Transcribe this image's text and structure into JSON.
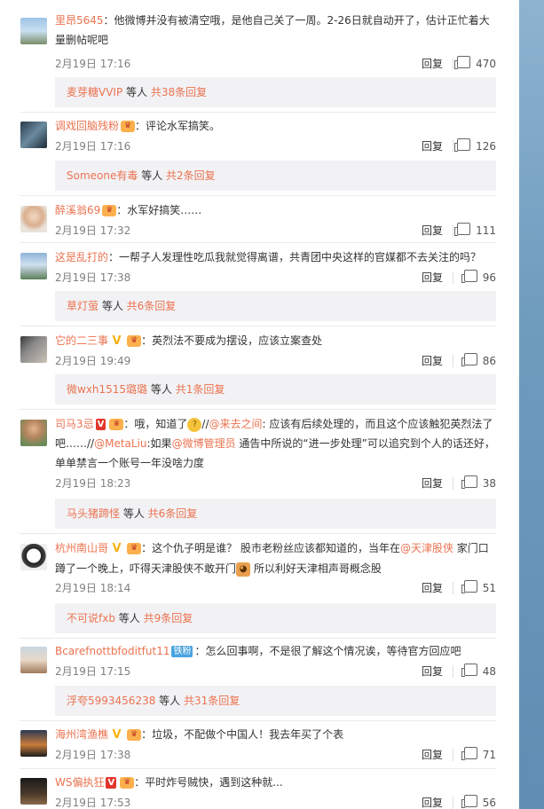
{
  "comments": [
    {
      "user": "里昂5645",
      "text": "：他微博并没有被清空哦，是他自己关了一周。2-26日就自动开了，估计正忙着大量删帖呢吧",
      "date": "2月19日 17:16",
      "reply": "回复",
      "likes": "470",
      "sub": {
        "user": "麦芽糖VVIP",
        "mid": " 等人 ",
        "count": "共38条回复"
      }
    },
    {
      "user": "调戏回脑残粉",
      "text": "：评论水军搞笑。",
      "date": "2月19日 17:16",
      "reply": "回复",
      "likes": "126",
      "sub": {
        "user": "Someone有毒",
        "mid": " 等人 ",
        "count": "共2条回复"
      }
    },
    {
      "user": "醉溪翁69",
      "text": "：水军好搞笑……",
      "date": "2月19日 17:32",
      "reply": "回复",
      "likes": "111"
    },
    {
      "user": "这是乱打的",
      "text": "：一帮子人发理性吃瓜我就觉得离谱，共青团中央这样的官媒都不去关注的吗？",
      "date": "2月19日 17:38",
      "reply": "回复",
      "likes": "96",
      "sub": {
        "user": "草灯萤",
        "mid": " 等人 ",
        "count": "共6条回复"
      }
    },
    {
      "user": "它的二三事",
      "text": "：英烈法不要成为摆设，应该立案查处",
      "date": "2月19日 19:49",
      "reply": "回复",
      "likes": "86",
      "sub": {
        "user": "微wxh1515璐璐",
        "mid": " 等人 ",
        "count": "共1条回复"
      }
    },
    {
      "user": "司马3忌",
      "text_a": "：哦，知道了",
      "text_b": "//",
      "mention1": "@来去之间",
      "text_c": ": 应该有后续处理的，而且这个应该触犯英烈法了吧……//",
      "mention2": "@MetaLiu",
      "text_d": ":如果",
      "mention3": "@微博管理员",
      "text_e": " 通告中所说的“进一步处理”可以追究到个人的话还好，单单禁言一个账号一年没啥力度",
      "date": "2月19日 18:23",
      "reply": "回复",
      "likes": "38",
      "sub": {
        "user": "马头猪蹄怪",
        "mid": " 等人 ",
        "count": "共6条回复"
      }
    },
    {
      "user": "杭州南山哥",
      "text_a": "：这个仇子明是谁？ 股市老粉丝应该都知道的，当年在",
      "mention1": "@天津股侠",
      "text_b": " 家门口蹲了一个晚上，吓得天津股侠不敢开门",
      "text_c": " 所以利好天津相声哥概念股",
      "date": "2月19日 18:14",
      "reply": "回复",
      "likes": "51",
      "sub": {
        "user": "不可说fxb",
        "mid": " 等人 ",
        "count": "共9条回复"
      }
    },
    {
      "user": "Bcarefnottbfoditfut11",
      "badge": "铁粉",
      "text": "：怎么回事啊，不是很了解这个情况诶，等待官方回应吧",
      "date": "2月19日 17:15",
      "reply": "回复",
      "likes": "48",
      "sub": {
        "user": "浮夸5993456238",
        "mid": " 等人 ",
        "count": "共31条回复"
      }
    },
    {
      "user": "海州湾渔樵",
      "text": "：垃圾，不配做个中国人！我去年买了个表",
      "date": "2月19日 17:38",
      "reply": "回复",
      "likes": "71"
    },
    {
      "user": "WS偏执狂",
      "text": "：平时炸号贼快，遇到这种就...",
      "date": "2月19日 17:53",
      "reply": "回复",
      "likes": "56"
    }
  ],
  "colors": {
    "link": "#eb7350",
    "meta": "#808080",
    "subbox": "#f2f2f5"
  }
}
